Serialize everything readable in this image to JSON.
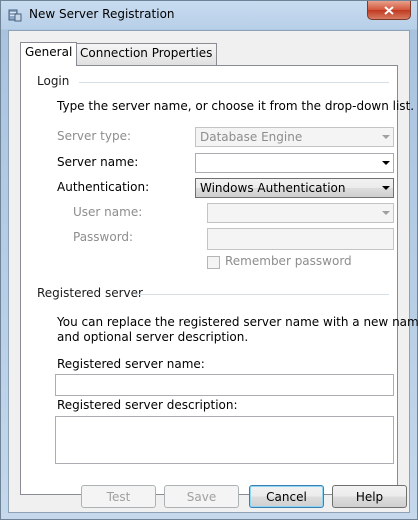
{
  "window": {
    "title": "New Server Registration"
  },
  "tabs": [
    {
      "label": "General",
      "active": true
    },
    {
      "label": "Connection Properties",
      "active": false
    }
  ],
  "login": {
    "group_label": "Login",
    "instruction": "Type the server name, or choose it from the drop-down list.",
    "server_type": {
      "label": "Server type:",
      "value": "Database Engine"
    },
    "server_name": {
      "label": "Server name:",
      "value": ""
    },
    "authentication": {
      "label": "Authentication:",
      "value": "Windows Authentication"
    },
    "user_name": {
      "label": "User name:",
      "value": ""
    },
    "password": {
      "label": "Password:",
      "value": ""
    },
    "remember_password": {
      "label": "Remember password",
      "checked": false
    }
  },
  "registered_server": {
    "group_label": "Registered server",
    "instruction_line1": "You can replace the registered server name with a new name",
    "instruction_line2": "and optional server description.",
    "name": {
      "label": "Registered server name:",
      "value": ""
    },
    "description": {
      "label": "Registered server description:",
      "value": ""
    }
  },
  "buttons": {
    "test": "Test",
    "save": "Save",
    "cancel": "Cancel",
    "help": "Help"
  }
}
